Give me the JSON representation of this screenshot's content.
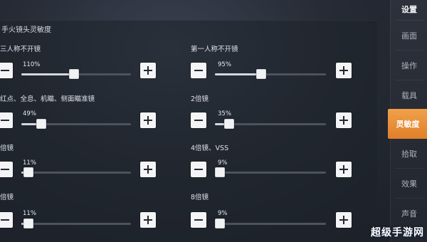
{
  "section_title": "手火镜头灵敏度",
  "settings": [
    {
      "label": "三人称不开镜",
      "percent": "110%",
      "value": 0.48
    },
    {
      "label": "第一人称不开镜",
      "percent": "95%",
      "value": 0.41
    },
    {
      "label": "红点、全息、机瞄、侧面瞄准镜",
      "percent": "49%",
      "value": 0.15
    },
    {
      "label": "2倍镜",
      "percent": "35%",
      "value": 0.09
    },
    {
      "label": "倍镜",
      "percent": "11%",
      "value": 0.02
    },
    {
      "label": "4倍镜、VSS",
      "percent": "9%",
      "value": 0.0
    },
    {
      "label": "倍镜",
      "percent": "11%",
      "value": 0.02
    },
    {
      "label": "8倍镜",
      "percent": "9%",
      "value": 0.0
    }
  ],
  "buttons": {
    "minus": "−",
    "plus": "+"
  },
  "menu": {
    "head": "设置",
    "items": [
      "画面",
      "操作",
      "载具",
      "灵敏度",
      "拾取",
      "效果",
      "声音"
    ],
    "active_index": 3
  },
  "watermark": "超级手游网",
  "colors": {
    "accent": "#e8903a"
  }
}
